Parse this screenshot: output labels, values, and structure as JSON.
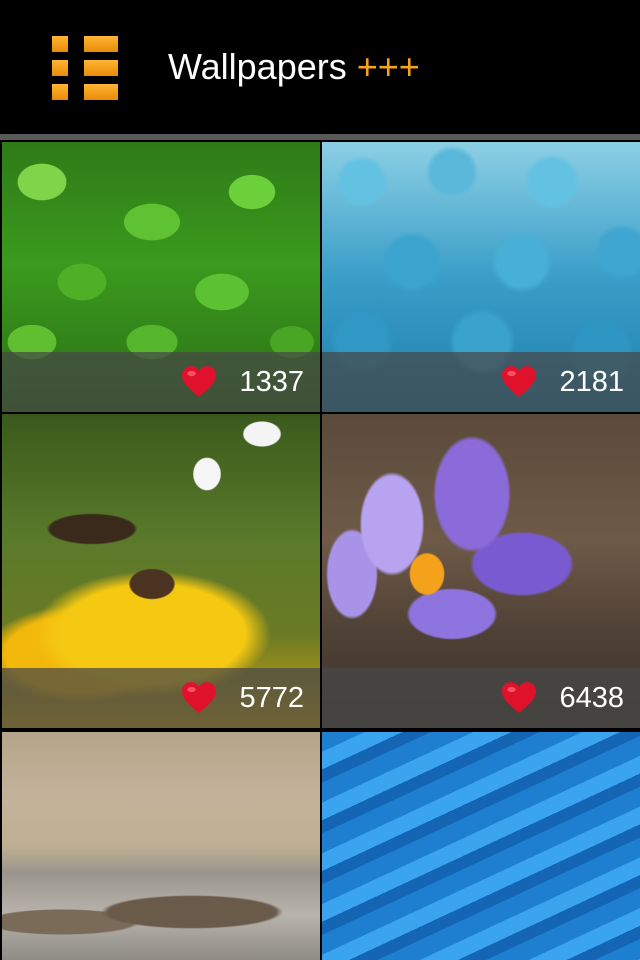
{
  "header": {
    "title": "Wallpapers",
    "title_accent": "+++",
    "menu_icon": "menu-grid-icon",
    "accent_color": "#f7a21b"
  },
  "wallpapers": [
    {
      "subject": "clover",
      "likes": "1337",
      "heart_icon": "heart-icon"
    },
    {
      "subject": "blue-fluff",
      "likes": "2181",
      "heart_icon": "heart-icon"
    },
    {
      "subject": "bee-on-flower",
      "likes": "5772",
      "heart_icon": "heart-icon"
    },
    {
      "subject": "purple-crocus",
      "likes": "6438",
      "heart_icon": "heart-icon"
    },
    {
      "subject": "lizard-on-rock"
    },
    {
      "subject": "blue-rope"
    }
  ],
  "colors": {
    "background": "#000000",
    "heart": "#e0112b",
    "overlay": "#464646"
  }
}
